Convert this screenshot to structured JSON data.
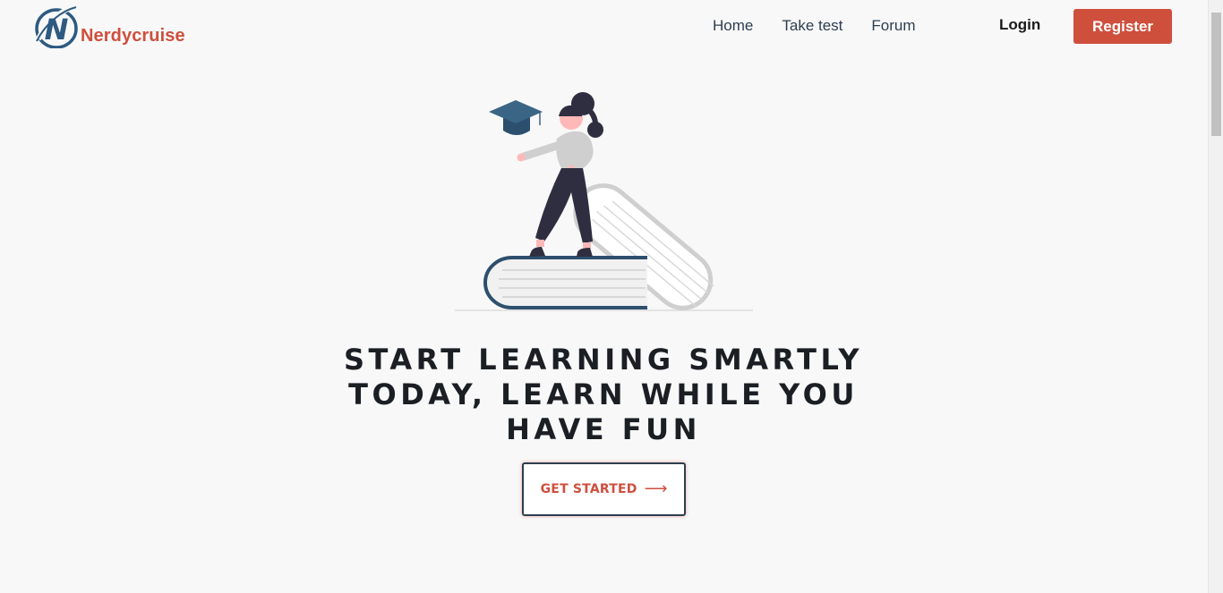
{
  "brand": {
    "name": "Nerdycruise",
    "logo_letter": "N",
    "primary_color": "#cf4f3d",
    "navy_color": "#2d5a80"
  },
  "nav": {
    "links": [
      "Home",
      "Take test",
      "Forum"
    ],
    "login_label": "Login",
    "register_label": "Register"
  },
  "hero": {
    "headline": "START LEARNING SMARTLY TODAY, LEARN WHILE YOU HAVE FUN",
    "cta_label": "GET STARTED",
    "cta_arrow": "⟶"
  }
}
